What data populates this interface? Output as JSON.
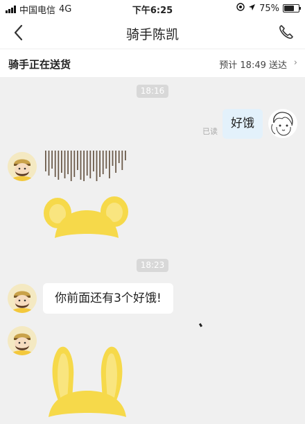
{
  "status_bar": {
    "carrier": "中国电信",
    "network": "4G",
    "time": "下午6:25",
    "battery": "75%",
    "battery_level": 0.75
  },
  "header": {
    "title": "骑手陈凯"
  },
  "delivery": {
    "status": "骑手正在送货",
    "eta": "预计 18:49 送达"
  },
  "messages": {
    "timestamp_1": "18:16",
    "outgoing_text": "好饿",
    "read_label": "已读",
    "timestamp_2": "18:23",
    "incoming_text": "你前面还有3个好饿!"
  },
  "colors": {
    "outgoing_bubble": "#e3f1fb",
    "incoming_bubble": "#ffffff",
    "background": "#f0f0f0",
    "sticker_yellow": "#f6d94a"
  },
  "icons": [
    "back-icon",
    "phone-icon",
    "location-icon",
    "arrow-icon",
    "chevron-right-icon",
    "doodle-girl-avatar",
    "rider-avatar",
    "sticker-ears",
    "sticker-bunny-ears"
  ]
}
